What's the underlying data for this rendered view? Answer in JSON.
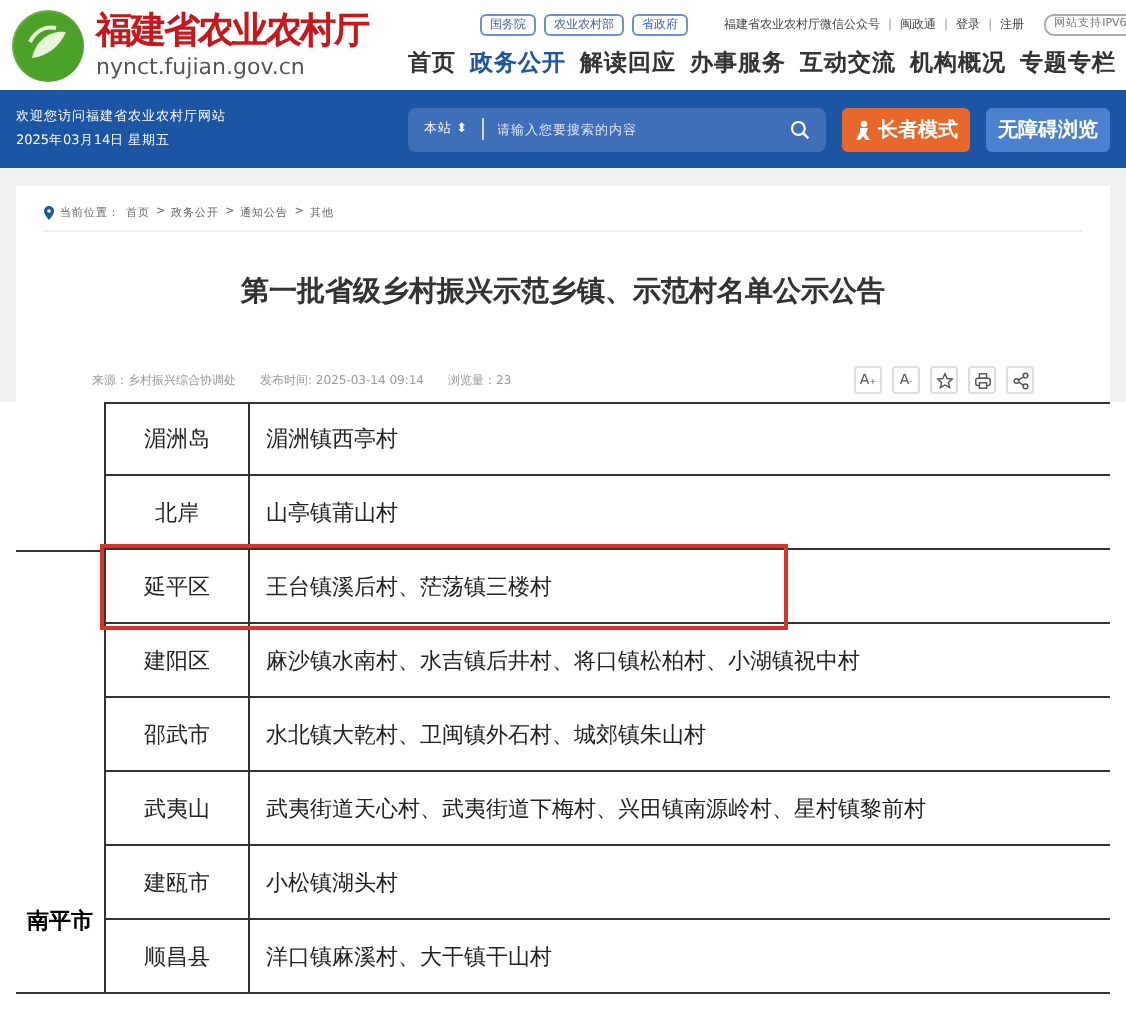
{
  "header": {
    "site_name": "福建省农业农村厅",
    "domain": "nynct.fujian.gov.cn",
    "top_links": [
      "国务院",
      "农业农村部",
      "省政府"
    ],
    "utility_links": [
      "福建省农业农村厅微信公众号",
      "闽政通",
      "登录",
      "注册"
    ],
    "utility_separator": "|",
    "ipv6_badge": "网站支持IPV6",
    "nav": [
      {
        "label": "首页",
        "selected": false
      },
      {
        "label": "政务公开",
        "selected": true
      },
      {
        "label": "解读回应",
        "selected": false
      },
      {
        "label": "办事服务",
        "selected": false
      },
      {
        "label": "互动交流",
        "selected": false
      },
      {
        "label": "机构概况",
        "selected": false
      },
      {
        "label": "专题专栏",
        "selected": false
      }
    ]
  },
  "bar": {
    "welcome": "欢迎您访问福建省农业农村厅网站",
    "date": "2025年03月14日 星期五",
    "scope": "本站",
    "scope_arrow": "⬍",
    "placeholder": "请输入您要搜索的内容",
    "elder_mode": "长者模式",
    "accessible": "无障碍浏览"
  },
  "breadcrumb": {
    "label": "当前位置：",
    "items": [
      "首页",
      "政务公开",
      "通知公告",
      "其他"
    ],
    "separator": ">"
  },
  "article": {
    "title": "第一批省级乡村振兴示范乡镇、示范村名单公示公告",
    "source": "来源：乡村振兴综合协调处",
    "published": "发布时间: 2025-03-14 09:14",
    "views": "浏览量：23",
    "tools": [
      {
        "kind": "font-up",
        "label": "A",
        "sign": "+"
      },
      {
        "kind": "font-down",
        "label": "A",
        "sign": "-"
      },
      {
        "kind": "star"
      },
      {
        "kind": "print"
      },
      {
        "kind": "share"
      }
    ]
  },
  "table": {
    "groups": [
      {
        "rows": [
          {
            "district": "湄洲岛",
            "villages": "湄洲镇西亭村",
            "highlighted": false
          },
          {
            "district": "北岸",
            "villages": "山亭镇莆山村",
            "highlighted": false
          }
        ]
      },
      {
        "city": "南平市",
        "rows": [
          {
            "district": "延平区",
            "villages": "王台镇溪后村、茫荡镇三楼村",
            "highlighted": true
          },
          {
            "district": "建阳区",
            "villages": "麻沙镇水南村、水吉镇后井村、将口镇松柏村、小湖镇祝中村",
            "highlighted": false
          },
          {
            "district": "邵武市",
            "villages": "水北镇大乾村、卫闽镇外石村、城郊镇朱山村",
            "highlighted": false
          },
          {
            "district": "武夷山",
            "villages": "武夷街道天心村、武夷街道下梅村、兴田镇南源岭村、星村镇黎前村",
            "highlighted": false
          },
          {
            "district": "建瓯市",
            "villages": "小松镇湖头村",
            "highlighted": false
          },
          {
            "district": "顺昌县",
            "villages": "洋口镇麻溪村、大干镇干山村",
            "highlighted": false
          }
        ]
      }
    ]
  }
}
